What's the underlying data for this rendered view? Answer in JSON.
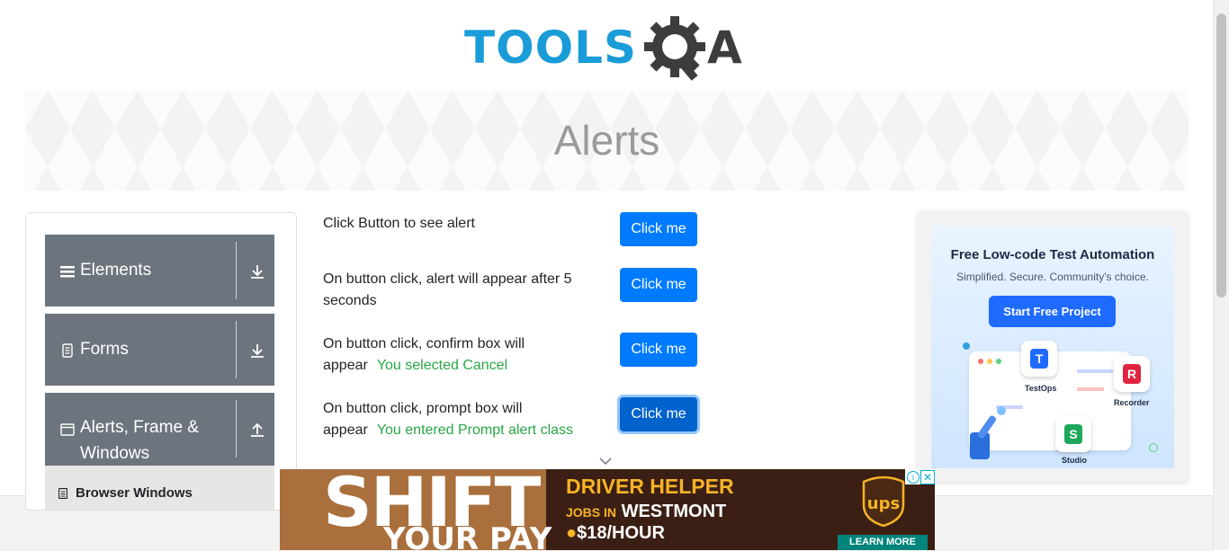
{
  "header": {
    "logo_text": "TOOLS",
    "logo_suffix": "A"
  },
  "banner": {
    "title": "Alerts"
  },
  "sidebar": {
    "groups": [
      {
        "label": "Elements",
        "icon": "hamburger-icon",
        "arrow": "download-arrow-icon"
      },
      {
        "label": "Forms",
        "icon": "document-icon",
        "arrow": "download-arrow-icon"
      },
      {
        "label": "Alerts, Frame & Windows",
        "icon": "window-icon",
        "arrow": "upload-arrow-icon"
      }
    ],
    "subitems": [
      {
        "label": "Browser Windows",
        "icon": "document-icon"
      }
    ]
  },
  "alerts": {
    "button_label": "Click me",
    "rows": [
      {
        "text": "Click Button to see alert",
        "result": ""
      },
      {
        "text": "On button click, alert will appear after 5 seconds",
        "result": ""
      },
      {
        "text": "On button click, confirm box will appear",
        "result": "You selected Cancel"
      },
      {
        "text": "On button click, prompt box will appear",
        "result": "You entered Prompt alert class"
      }
    ]
  },
  "ad_right": {
    "title": "Free Low-code Test Automation",
    "subtitle": "Simplified. Secure. Community's choice.",
    "cta": "Start Free Project",
    "apps": [
      {
        "letter": "T",
        "label": "TestOps"
      },
      {
        "letter": "R",
        "label": "Recorder"
      },
      {
        "letter": "S",
        "label": "Studio"
      }
    ]
  },
  "ad_bottom": {
    "headline_1": "SHIFT",
    "headline_2": "YOUR PAY",
    "role": "DRIVER HELPER",
    "jobs_prefix": "JOBS IN",
    "location": "WESTMONT",
    "wage": "$18/HOUR",
    "brand": "ups",
    "cta": "LEARN MORE"
  },
  "colors": {
    "primary_button": "#007bff",
    "sidebar_group": "#6c757d",
    "success_text": "#28a745",
    "logo_blue": "#1a9cd8"
  }
}
